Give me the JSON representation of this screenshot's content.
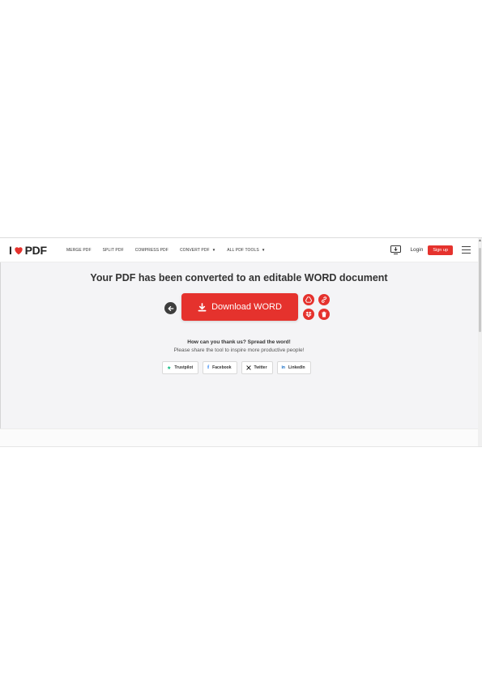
{
  "brand": {
    "logo_left": "I",
    "logo_right": "PDF",
    "accent": "#e5322d"
  },
  "nav": {
    "links": [
      {
        "label": "MERGE PDF"
      },
      {
        "label": "SPLIT PDF"
      },
      {
        "label": "COMPRESS PDF"
      },
      {
        "label": "CONVERT PDF",
        "caret": "▼"
      },
      {
        "label": "ALL PDF TOOLS",
        "caret": "▼"
      }
    ],
    "desktop_icon": "desktop-download-icon",
    "login": "Login",
    "signup": "Sign up",
    "menu_icon": "hamburger-icon"
  },
  "main": {
    "title": "Your PDF has been converted to an editable WORD document",
    "download_label": "Download WORD",
    "back_icon": "arrow-left-icon",
    "actions": [
      "google-drive-icon",
      "link-icon",
      "dropbox-icon",
      "trash-icon"
    ],
    "thanks": "How can you thank us? Spread the word!",
    "share": "Please share the tool to inspire more productive people!",
    "socials": [
      {
        "label": "Trustpilot",
        "icon": "star-icon",
        "color": "#00b67a"
      },
      {
        "label": "Facebook",
        "icon": "facebook-icon",
        "color": "#1877f2"
      },
      {
        "label": "Twitter",
        "icon": "x-icon",
        "color": "#111111"
      },
      {
        "label": "LinkedIn",
        "icon": "linkedin-icon",
        "color": "#0a66c2"
      }
    ]
  }
}
